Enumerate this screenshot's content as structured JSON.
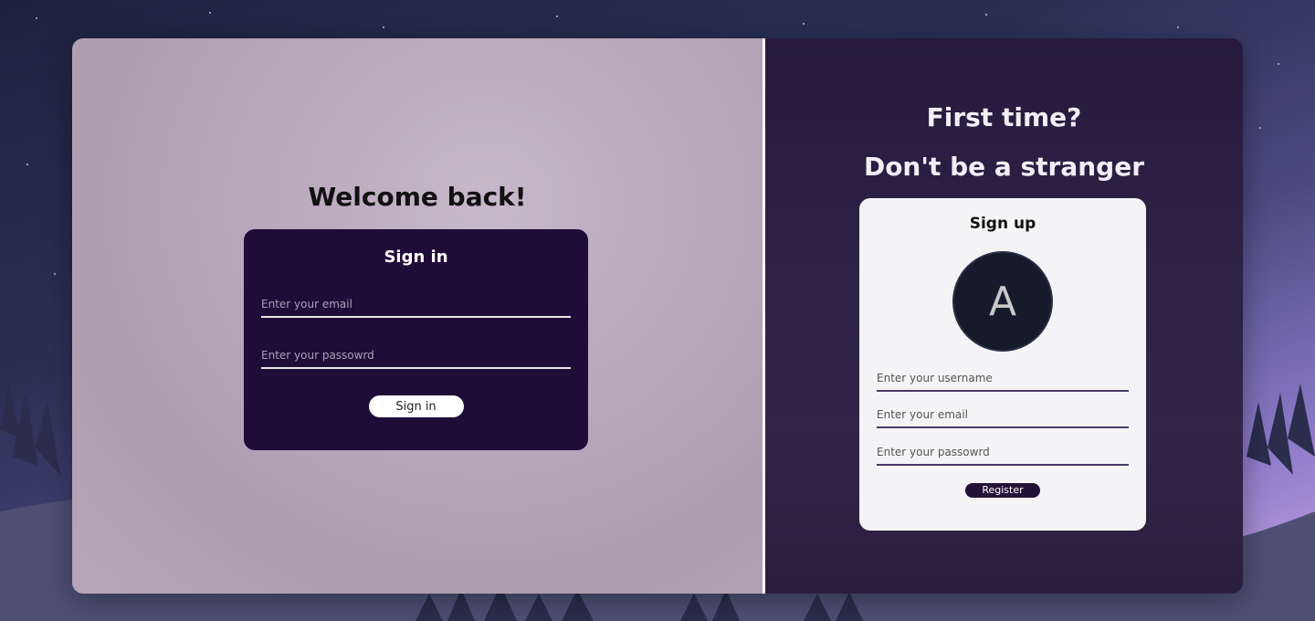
{
  "left_panel": {
    "welcome_title": "Welcome back!",
    "signin_card": {
      "title": "Sign in",
      "email_placeholder": "Enter your email",
      "password_placeholder": "Enter your passowrd",
      "button_label": "Sign in"
    }
  },
  "right_panel": {
    "headline_line1": "First time?",
    "headline_line2": "Don't be a stranger",
    "signup_card": {
      "title": "Sign up",
      "avatar_letter": "A",
      "username_placeholder": "Enter your username",
      "email_placeholder": "Enter your email",
      "password_placeholder": "Enter your passowrd",
      "button_label": "Register"
    }
  },
  "colors": {
    "signin_card_bg": "#1f0d38",
    "register_button_bg": "#241338",
    "avatar_bg": "#161b2c"
  }
}
